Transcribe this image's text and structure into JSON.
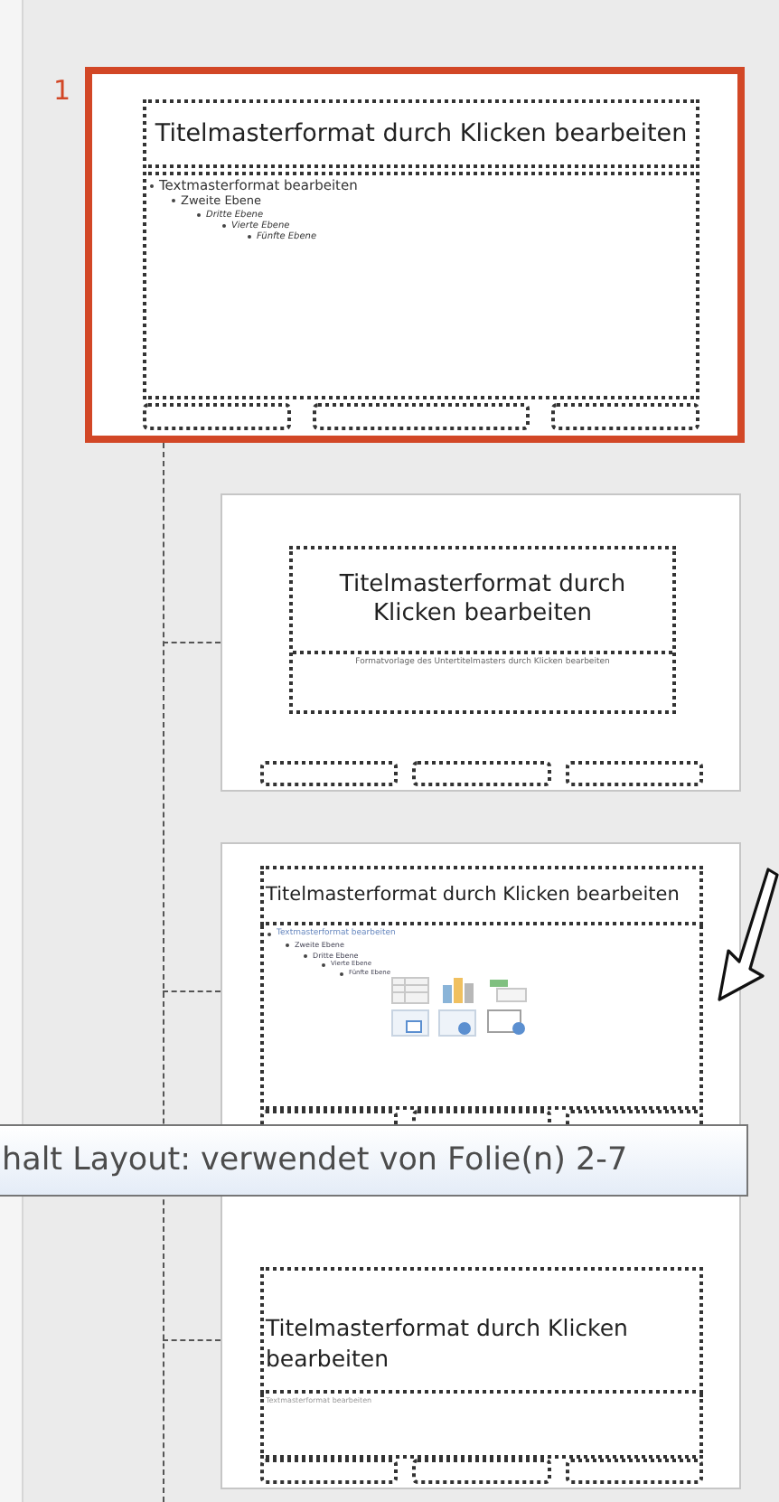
{
  "slides": [
    {
      "number": "1",
      "selected": true,
      "title": "Titelmasterformat durch Klicken bearbeiten",
      "levels": [
        "Textmasterformat bearbeiten",
        "Zweite Ebene",
        "Dritte Ebene",
        "Vierte Ebene",
        "Fünfte Ebene"
      ]
    },
    {
      "selected": false,
      "kind": "title",
      "title": "Titelmasterformat durch Klicken bearbeiten",
      "subtitle": "Formatvorlage des Untertitelmasters durch Klicken bearbeiten"
    },
    {
      "selected": false,
      "kind": "content",
      "title": "Titelmasterformat durch Klicken bearbeiten",
      "levels": [
        "Textmasterformat bearbeiten",
        "Zweite Ebene",
        "Dritte Ebene",
        "Vierte Ebene",
        "Fünfte Ebene"
      ]
    },
    {
      "selected": false,
      "kind": "section",
      "title": "Titelmasterformat durch Klicken bearbeiten",
      "body": "Textmasterformat bearbeiten"
    }
  ],
  "tooltip": {
    "text": "halt Layout: verwendet von Folie(n) 2-7"
  }
}
